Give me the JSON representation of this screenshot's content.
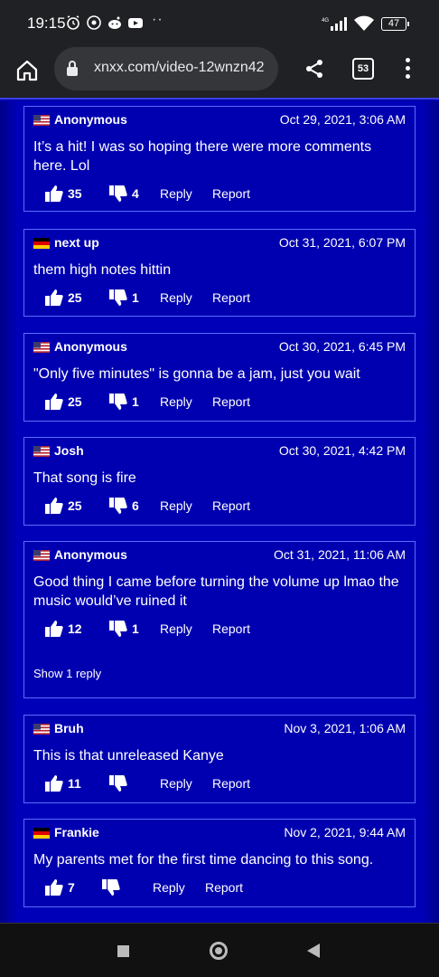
{
  "status_bar": {
    "time": "19:15",
    "network": "4G",
    "battery": "47"
  },
  "browser": {
    "url": "xnxx.com/video-12wnzn42",
    "tab_count": "53"
  },
  "labels": {
    "reply": "Reply",
    "report": "Report"
  },
  "comments": [
    {
      "author": "Anonymous",
      "flag": "us",
      "date": "Oct 29, 2021, 3:06 AM",
      "text": "It’s a hit! I was so hoping there were more comments here. Lol",
      "likes": "35",
      "dislikes": "4"
    },
    {
      "author": "next up",
      "flag": "de",
      "date": "Oct 31, 2021, 6:07 PM",
      "text": "them high notes hittin",
      "likes": "25",
      "dislikes": "1"
    },
    {
      "author": "Anonymous",
      "flag": "us",
      "date": "Oct 30, 2021, 6:45 PM",
      "text": "\"Only five minutes\" is gonna be a jam, just you wait",
      "likes": "25",
      "dislikes": "1"
    },
    {
      "author": "Josh",
      "flag": "us",
      "date": "Oct 30, 2021, 4:42 PM",
      "text": "That song is fire",
      "likes": "25",
      "dislikes": "6"
    },
    {
      "author": "Anonymous",
      "flag": "us",
      "date": "Oct 31, 2021, 11:06 AM",
      "text": "Good thing I came before turning the volume up lmao the music would’ve ruined it",
      "likes": "12",
      "dislikes": "1",
      "show_replies": "Show 1 reply"
    },
    {
      "author": "Bruh",
      "flag": "us",
      "date": "Nov 3, 2021, 1:06 AM",
      "text": "This is that unreleased Kanye",
      "likes": "11",
      "dislikes": ""
    },
    {
      "author": "Frankie",
      "flag": "de",
      "date": "Nov 2, 2021, 9:44 AM",
      "text": "My parents met for the first time dancing to this song.",
      "likes": "7",
      "dislikes": ""
    }
  ]
}
